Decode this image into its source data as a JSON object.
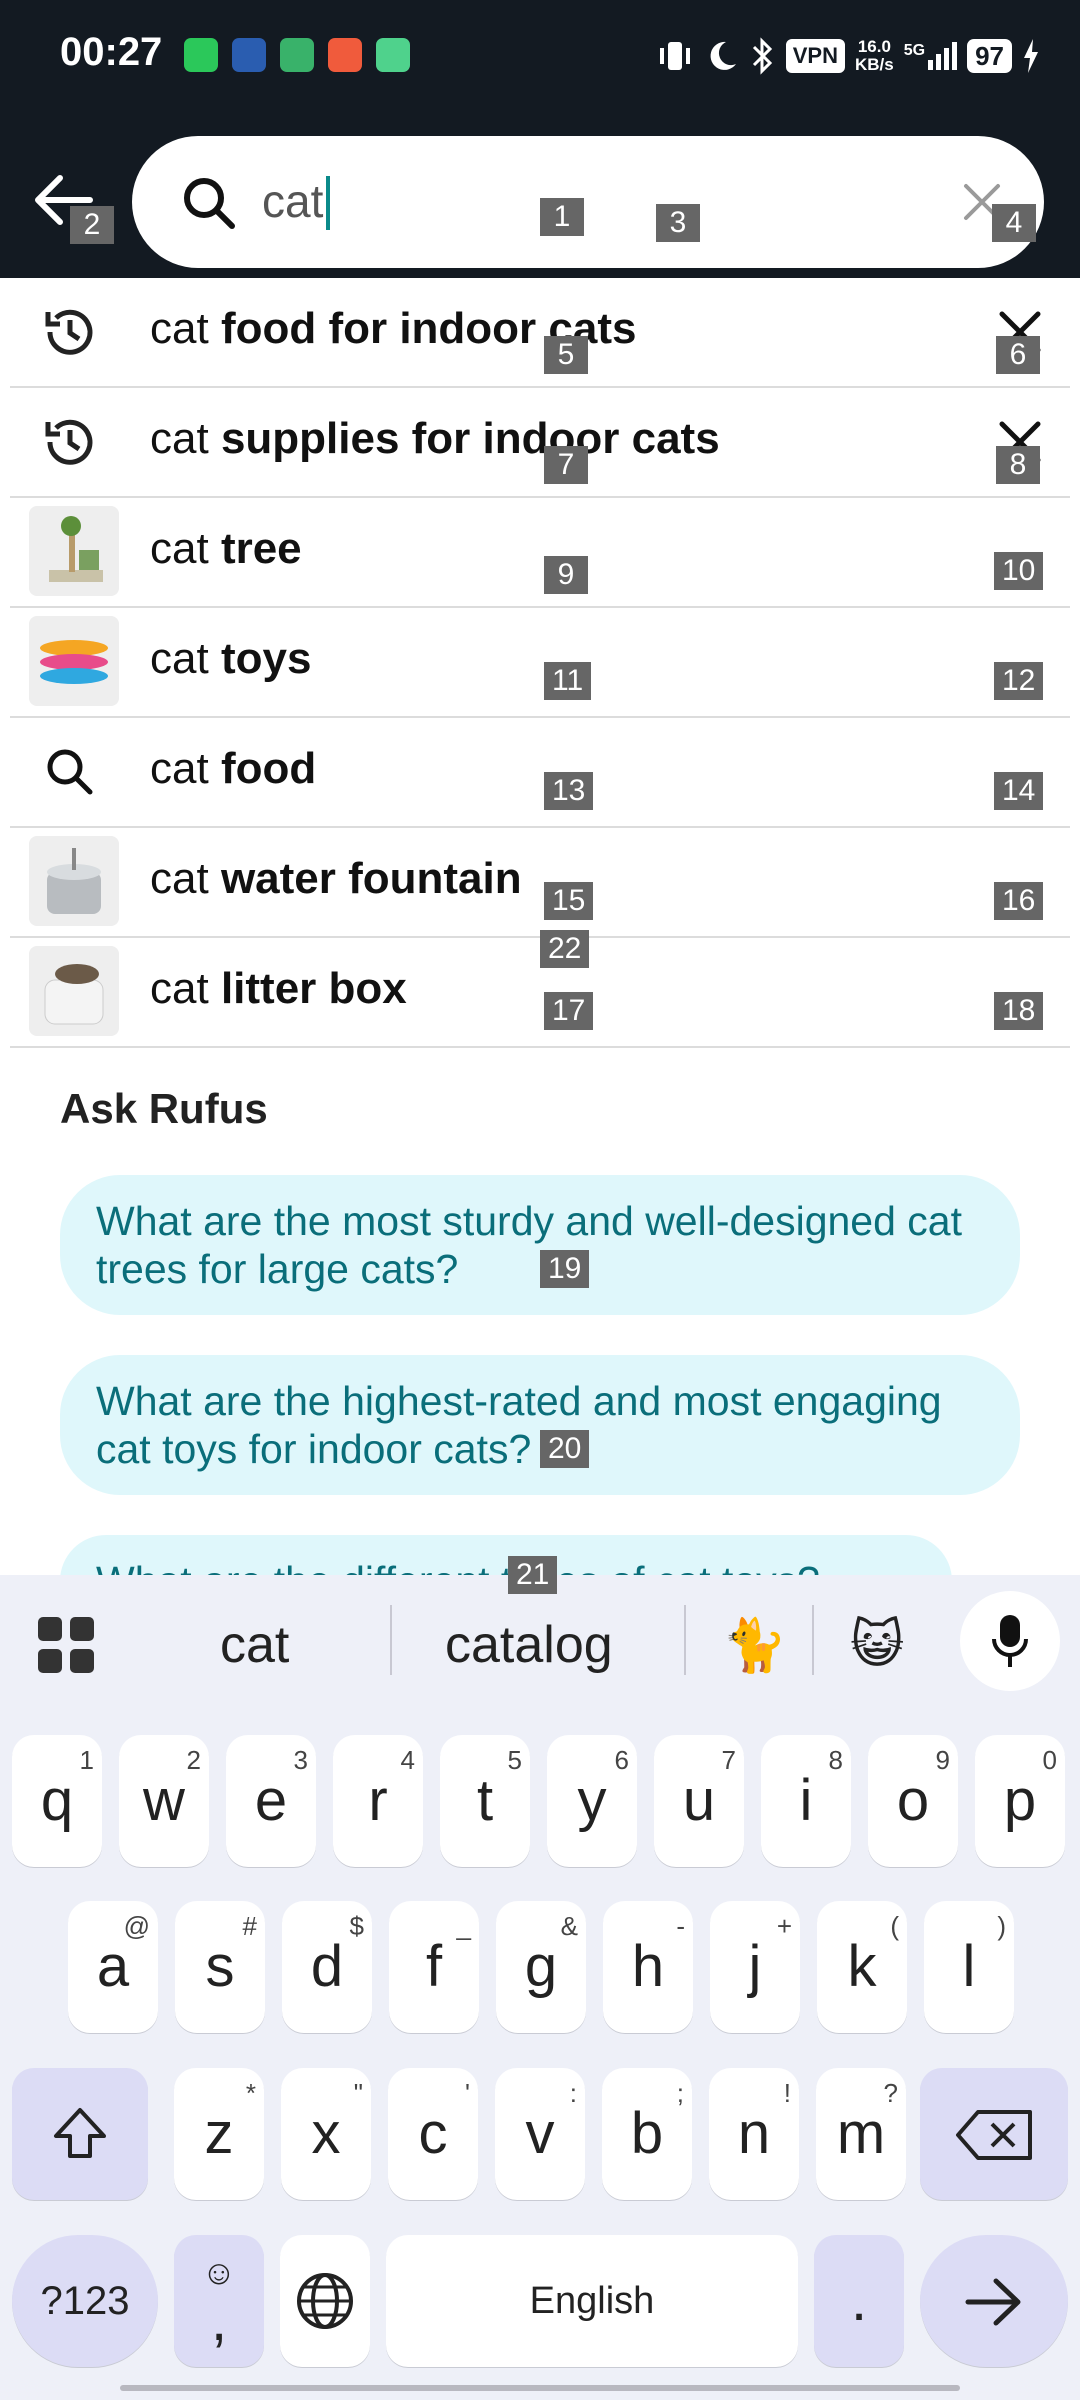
{
  "status": {
    "time": "00:27",
    "vpn": "VPN",
    "net_speed": "16.0",
    "net_unit": "KB/s",
    "net_type": "5G",
    "battery": "97"
  },
  "search": {
    "value": "cat",
    "back_icon": "arrow-left-icon",
    "search_icon": "search-icon",
    "clear_icon": "close-icon"
  },
  "suggestions": [
    {
      "prefix": "cat",
      "bold": "food for indoor cats",
      "icon": "history-icon",
      "removable": true
    },
    {
      "prefix": "cat",
      "bold": "supplies for indoor cats",
      "icon": "history-icon",
      "removable": true
    },
    {
      "prefix": "cat",
      "bold": "tree",
      "icon": "cat-tree-thumbnail"
    },
    {
      "prefix": "cat",
      "bold": "toys",
      "icon": "cat-toys-thumbnail"
    },
    {
      "prefix": "cat",
      "bold": "food",
      "icon": "search-icon"
    },
    {
      "prefix": "cat",
      "bold": "water fountain",
      "icon": "water-fountain-thumbnail"
    },
    {
      "prefix": "cat",
      "bold": "litter box",
      "icon": "litter-box-thumbnail"
    }
  ],
  "rufus": {
    "title": "Ask Rufus",
    "questions": [
      "What are the most sturdy and well-designed cat trees for large cats?",
      "What are the highest-rated and most engaging cat toys for indoor cats?",
      "What are the different types of cat toys?"
    ]
  },
  "keyboard": {
    "suggestions": [
      "cat",
      "catalog"
    ],
    "emoji": [
      "🐈",
      "😺"
    ],
    "row1": [
      "q",
      "w",
      "e",
      "r",
      "t",
      "y",
      "u",
      "i",
      "o",
      "p"
    ],
    "row1_hints": [
      "1",
      "2",
      "3",
      "4",
      "5",
      "6",
      "7",
      "8",
      "9",
      "0"
    ],
    "row2": [
      "a",
      "s",
      "d",
      "f",
      "g",
      "h",
      "j",
      "k",
      "l"
    ],
    "row2_hints": [
      "@",
      "#",
      "$",
      "_",
      "&",
      "-",
      "+",
      "(",
      ")"
    ],
    "row3": [
      "z",
      "x",
      "c",
      "v",
      "b",
      "n",
      "m"
    ],
    "row3_hints": [
      "*",
      "\"",
      "'",
      ":",
      ";",
      "!",
      "?"
    ],
    "symbols_key": "?123",
    "comma": ",",
    "space_label": "English",
    "period": "."
  },
  "overlay_tags": [
    "1",
    "2",
    "3",
    "4",
    "5",
    "6",
    "7",
    "8",
    "9",
    "10",
    "11",
    "12",
    "13",
    "14",
    "15",
    "16",
    "17",
    "18",
    "19",
    "20",
    "21",
    "22"
  ]
}
